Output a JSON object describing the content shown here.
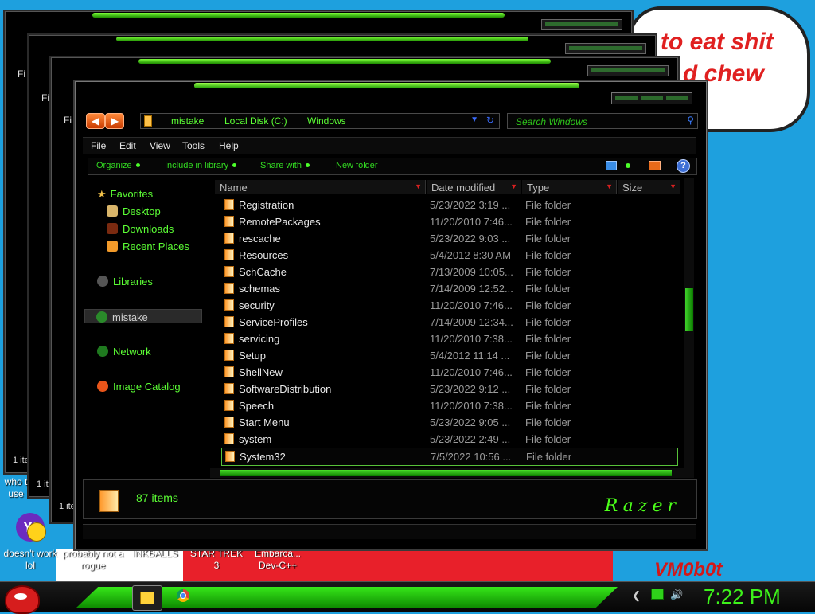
{
  "wallpaper": {
    "cloud_line1": "to eat shit",
    "cloud_line2": "d chew",
    "signature": "VM0b0t"
  },
  "desktop_icons": [
    {
      "label": "doesn't work lol"
    },
    {
      "label": "probably not a rogue"
    },
    {
      "label": "INKBALLS"
    },
    {
      "label": "STAR TREK 3"
    },
    {
      "label": "Embarca... Dev-C++"
    }
  ],
  "bg_windows": {
    "menu_stub": "Fi",
    "items_stub": "1 ite",
    "desktop_stub": "who t use"
  },
  "explorer": {
    "address": {
      "crumbs": [
        "mistake",
        "Local Disk (C:)",
        "Windows"
      ]
    },
    "search": {
      "placeholder": "Search Windows"
    },
    "menu": [
      "File",
      "Edit",
      "View",
      "Tools",
      "Help"
    ],
    "commands": [
      "Organize",
      "Include in library",
      "Share with",
      "New folder"
    ],
    "nav": {
      "favorites": "Favorites",
      "desktop": "Desktop",
      "downloads": "Downloads",
      "recent": "Recent Places",
      "libraries": "Libraries",
      "homegroup": "mistake",
      "network": "Network",
      "image_catalog": "Image Catalog"
    },
    "columns": [
      "Name",
      "Date modified",
      "Type",
      "Size"
    ],
    "rows": [
      {
        "name": "Registration",
        "date": "5/23/2022 3:19 ...",
        "type": "File folder"
      },
      {
        "name": "RemotePackages",
        "date": "11/20/2010 7:46...",
        "type": "File folder"
      },
      {
        "name": "rescache",
        "date": "5/23/2022 9:03 ...",
        "type": "File folder"
      },
      {
        "name": "Resources",
        "date": "5/4/2012 8:30 AM",
        "type": "File folder"
      },
      {
        "name": "SchCache",
        "date": "7/13/2009 10:05...",
        "type": "File folder"
      },
      {
        "name": "schemas",
        "date": "7/14/2009 12:52...",
        "type": "File folder"
      },
      {
        "name": "security",
        "date": "11/20/2010 7:46...",
        "type": "File folder"
      },
      {
        "name": "ServiceProfiles",
        "date": "7/14/2009 12:34...",
        "type": "File folder"
      },
      {
        "name": "servicing",
        "date": "11/20/2010 7:38...",
        "type": "File folder"
      },
      {
        "name": "Setup",
        "date": "5/4/2012 11:14 ...",
        "type": "File folder"
      },
      {
        "name": "ShellNew",
        "date": "11/20/2010 7:46...",
        "type": "File folder"
      },
      {
        "name": "SoftwareDistribution",
        "date": "5/23/2022 9:12 ...",
        "type": "File folder"
      },
      {
        "name": "Speech",
        "date": "11/20/2010 7:38...",
        "type": "File folder"
      },
      {
        "name": "Start Menu",
        "date": "5/23/2022 9:05 ...",
        "type": "File folder"
      },
      {
        "name": "system",
        "date": "5/23/2022 2:49 ...",
        "type": "File folder"
      },
      {
        "name": "System32",
        "date": "7/5/2022 10:56 ...",
        "type": "File folder"
      }
    ],
    "selected_row": "System32",
    "status": {
      "count": "87 items"
    },
    "brand": "Razer"
  },
  "taskbar": {
    "clock": "7:22 PM"
  },
  "colors": {
    "accent_green": "#5cff35",
    "desktop_blue": "#1ea0de"
  }
}
